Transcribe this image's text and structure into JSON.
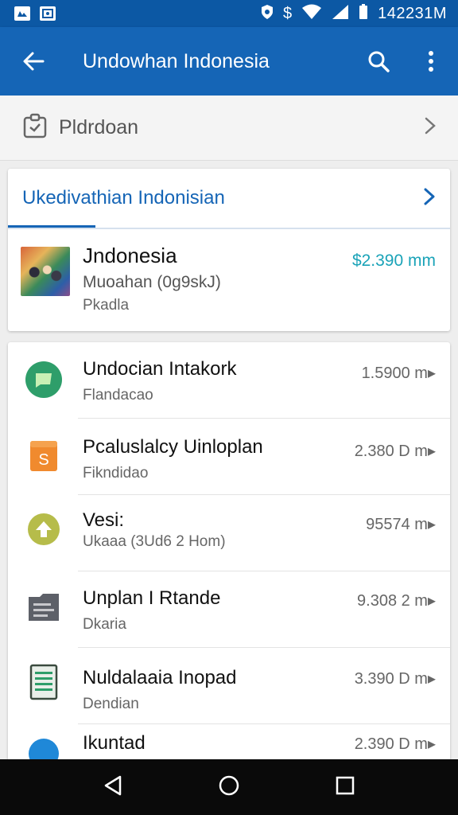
{
  "status_bar": {
    "left_icons": [
      "notification-icon",
      "notification-icon"
    ],
    "right_icons": [
      "shield-icon",
      "dollar-icon",
      "wifi-icon",
      "signal-icon",
      "battery-icon"
    ],
    "dollar_glyph": "$",
    "time": "142231M"
  },
  "app_bar": {
    "title": "Undowhan Indonesia",
    "actions": [
      "search-icon",
      "more-vert-icon"
    ]
  },
  "pill_row": {
    "label": "Pldrdoan"
  },
  "card_header": {
    "title": "Ukedivathian Indonisian"
  },
  "featured": {
    "title": "Jndonesia",
    "subtitle": "Muoahan (0g9skJ)",
    "meta": "Pkadla",
    "price": "$2.390 mm"
  },
  "list": [
    {
      "icon": "chat-icon",
      "title": "Undocian Intakork",
      "subtitle": "Flandacao",
      "value": "1.5900 m▸"
    },
    {
      "icon": "document-icon",
      "title": "Pcaluslalcy Uinloplan",
      "subtitle": "Fikndidao",
      "value": "2.380 D m▸"
    },
    {
      "icon": "upload-icon",
      "title": "Vesi:",
      "subtitle": "Ukaaa (3Ud6 2 Hom)",
      "value": "95574 m▸"
    },
    {
      "icon": "folder-icon",
      "title": "Unplan I Rtande",
      "subtitle": "Dkaria",
      "value": "9.308 2 m▸"
    },
    {
      "icon": "notepad-icon",
      "title": "Nuldalaaia Inopad",
      "subtitle": "Dendian",
      "value": "3.390 D m▸"
    },
    {
      "icon": "globe-icon",
      "title": "Ikuntad",
      "subtitle": "",
      "value": "2.390 D m▸"
    }
  ],
  "colors": {
    "status_bar": "#0c58a4",
    "app_bar": "#1565b6",
    "accent": "#1565b6",
    "price": "#1aa3b8"
  },
  "nav_bar": [
    "back-icon",
    "home-icon",
    "recents-icon"
  ]
}
